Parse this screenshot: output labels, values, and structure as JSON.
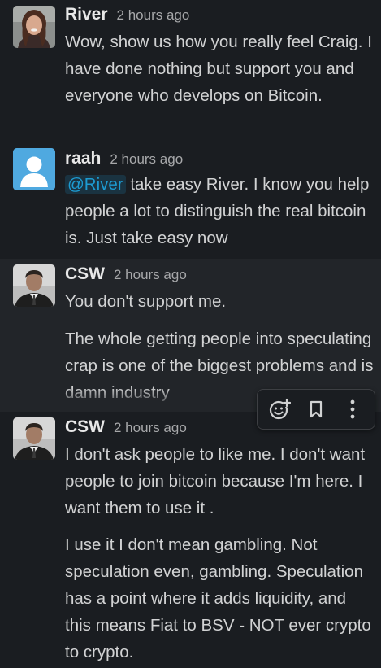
{
  "messages": [
    {
      "author": "River",
      "time": "2 hours ago",
      "avatar_icon": "profile-photo-icon",
      "paragraphs": [
        "Wow, show us how you really feel Craig. I have done nothing but support you and everyone who develops on Bitcoin."
      ]
    },
    {
      "author": "raah",
      "time": "2 hours ago",
      "avatar_icon": "default-user-icon",
      "mention": "@River",
      "paragraphs": [
        " take easy River. I know you help people a lot to distinguish the real bitcoin is. Just take easy now"
      ]
    },
    {
      "author": "CSW",
      "time": "2 hours ago",
      "avatar_icon": "profile-photo-icon",
      "paragraphs": [
        "You don't support me.",
        "The whole getting people into speculating crap is one of the biggest problems and is damn industry"
      ]
    },
    {
      "author": "CSW",
      "time": "2 hours ago",
      "avatar_icon": "profile-photo-icon",
      "paragraphs": [
        "I don't ask people to like me. I don't want people to join bitcoin because I'm here. I want them to use it .",
        "I use it I don't mean gambling. Not speculation even, gambling. Speculation has a point where it adds liquidity, and this means Fiat to BSV - NOT ever crypto to crypto."
      ]
    }
  ],
  "toolbar": {
    "icons": [
      "add-reaction-icon",
      "bookmark-icon",
      "more-actions-icon"
    ]
  },
  "colors": {
    "background": "#1a1d21",
    "hover_background": "#222529",
    "text": "#d1d2d3",
    "timestamp": "#a7a8aa",
    "mention": "#1d9bd1",
    "default_avatar": "#4fa9e0"
  }
}
